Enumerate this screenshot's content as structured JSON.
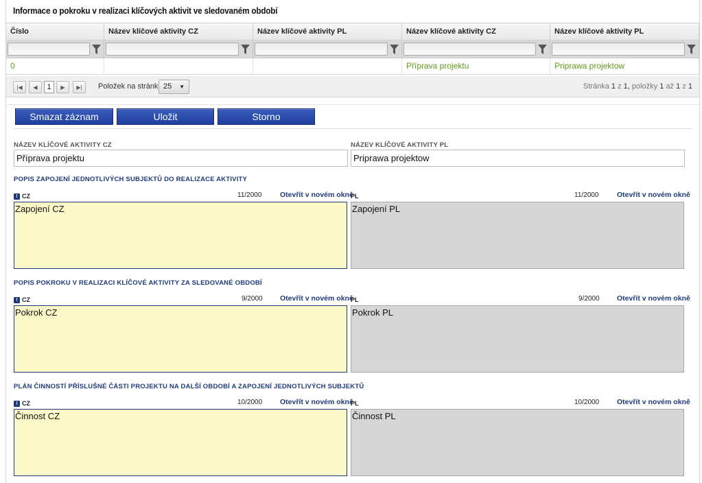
{
  "section_title": "Informace o pokroku v realizaci klíčových aktivit ve sledovaném období",
  "grid": {
    "headers": [
      "Číslo",
      "Název klíčové aktivity CZ",
      "Název klíčové aktivity PL",
      "Název klíčové aktivity CZ",
      "Název klíčové aktivity PL"
    ],
    "rows": [
      [
        "0",
        "",
        "",
        "Příprava projektu",
        "Priprawa projektow"
      ]
    ]
  },
  "pager": {
    "current_page": "1",
    "per_page_label": "Položek na stránku",
    "per_page_value": "25",
    "info_page_word": "Stránka",
    "info_page": "1",
    "info_of_word": "z",
    "info_total_pages": "1,",
    "info_items_word": "položky",
    "info_from": "1",
    "info_to_word": "až",
    "info_to": "1",
    "info_of2": "z",
    "info_total_items": "1"
  },
  "buttons": {
    "delete": "Smazat záznam",
    "save": "Uložit",
    "cancel": "Storno"
  },
  "form": {
    "name_cz_label": "Název klíčové aktivity CZ",
    "name_cz_value": "Příprava projektu",
    "name_pl_label": "Název klíčové aktivity PL",
    "name_pl_value": "Priprawa projektow",
    "open_link": "Otevřít v novém okně",
    "lang_cz": "CZ",
    "lang_pl": "PL",
    "sections": [
      {
        "title": "POPIS ZAPOJENÍ JEDNOTLIVÝCH SUBJEKTŮ DO REALIZACE AKTIVITY",
        "cz_count": "11/2000",
        "cz_text": "Zapojení CZ",
        "pl_count": "11/2000",
        "pl_text": "Zapojení PL"
      },
      {
        "title": "POPIS POKROKU V REALIZACI KLÍČOVÉ AKTIVITY ZA SLEDOVANÉ OBDOBÍ",
        "cz_count": "9/2000",
        "cz_text": "Pokrok CZ",
        "pl_count": "9/2000",
        "pl_text": "Pokrok PL"
      },
      {
        "title": "PLÁN ČINNOSTÍ PŘÍSLUŠNÉ ČÁSTI PROJEKTU NA DALŠÍ OBDOBÍ A ZAPOJENÍ JEDNOTLIVÝCH SUBJEKTŮ",
        "cz_count": "10/2000",
        "cz_text": "Činnost CZ",
        "pl_count": "10/2000",
        "pl_text": "Činnost PL"
      }
    ]
  },
  "colors": {
    "accent": "#1f3a7a",
    "button": "#2a4bad",
    "grid_value": "#5e9b1a",
    "cz_field": "#fcf8c8",
    "pl_field": "#d6d6d6"
  }
}
